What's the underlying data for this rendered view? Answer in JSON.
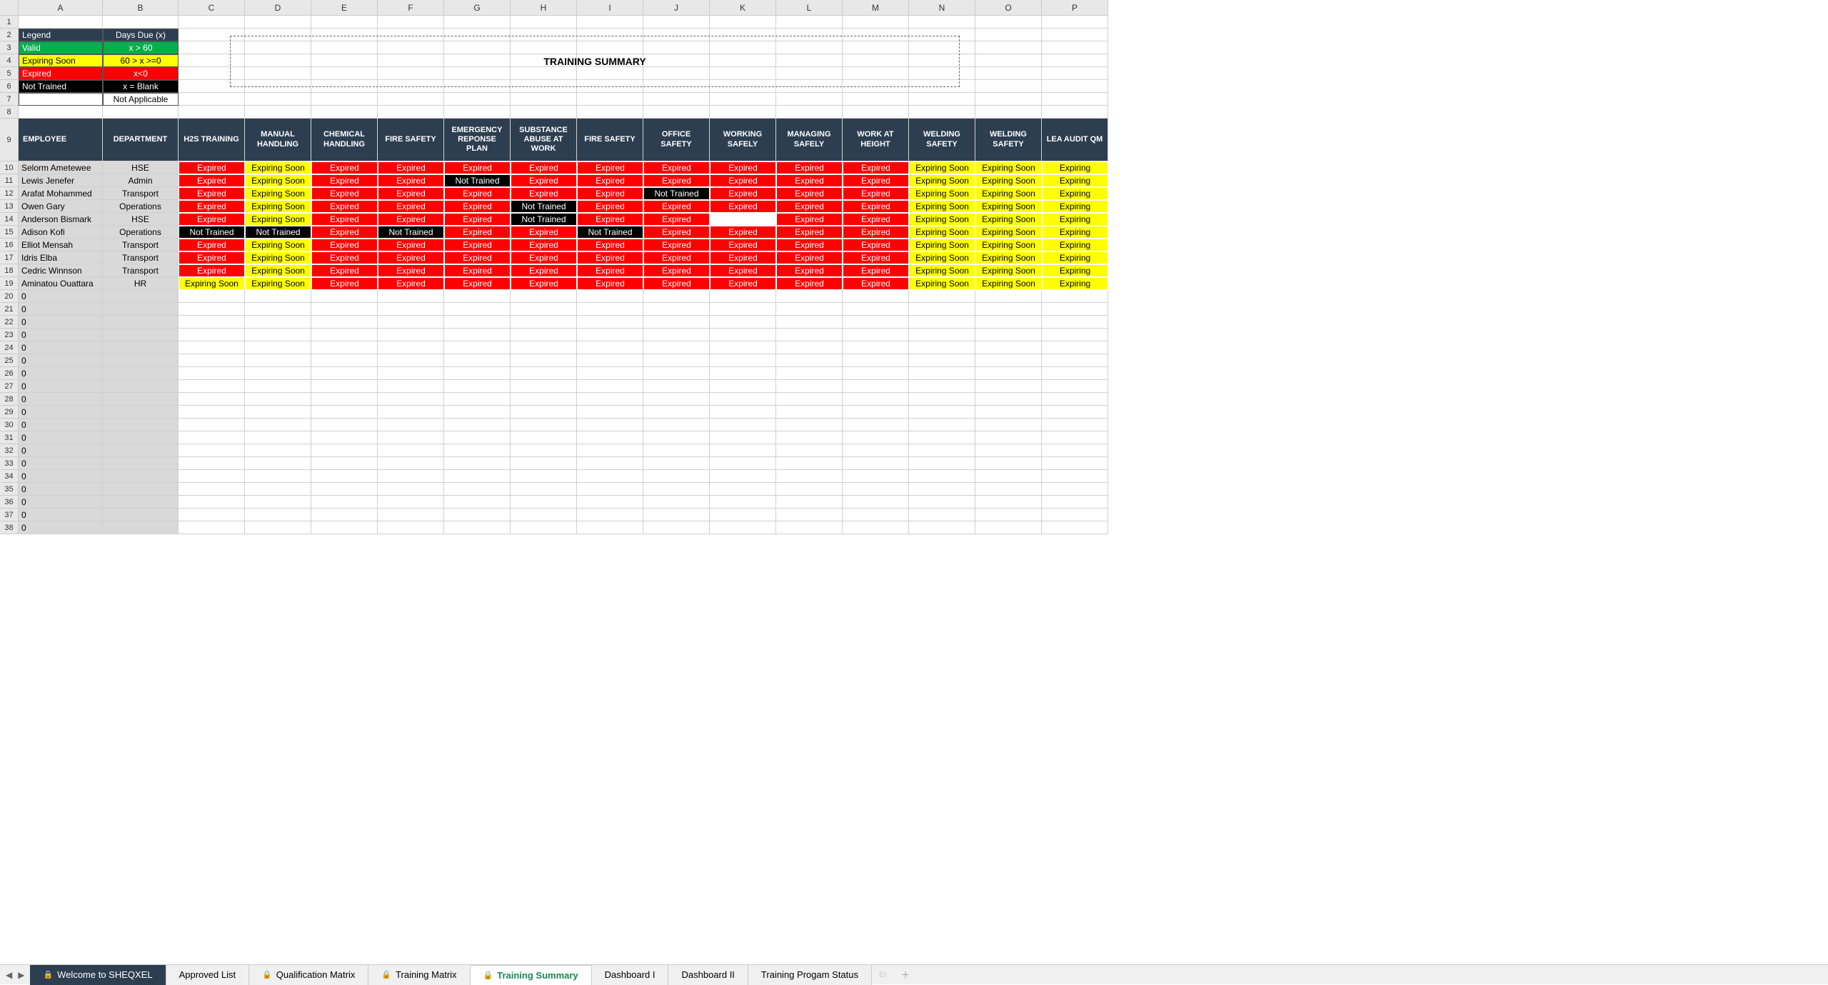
{
  "column_letters": [
    "A",
    "B",
    "C",
    "D",
    "E",
    "F",
    "G",
    "H",
    "I",
    "J",
    "K",
    "L",
    "M",
    "N",
    "O",
    "P"
  ],
  "visible_row_count": 38,
  "legend": {
    "header_left": "Legend",
    "header_right": "Days Due (x)",
    "rows": [
      {
        "label": "Valid",
        "rule": "x > 60",
        "cls": "legend-valid"
      },
      {
        "label": "Expiring Soon",
        "rule": "60 > x >=0",
        "cls": "legend-soon"
      },
      {
        "label": "Expired",
        "rule": "x<0",
        "cls": "legend-expired"
      },
      {
        "label": "Not Trained",
        "rule": "x = Blank",
        "cls": "legend-nottrained"
      },
      {
        "label": "",
        "rule": "Not Applicable",
        "cls": "legend-na"
      }
    ]
  },
  "title": "TRAINING SUMMARY",
  "table_headers": [
    "EMPLOYEE",
    "DEPARTMENT",
    "H2S TRAINING",
    "MANUAL HANDLING",
    "CHEMICAL HANDLING",
    "FIRE SAFETY",
    "EMERGENCY REPONSE PLAN",
    "SUBSTANCE ABUSE AT WORK",
    "FIRE SAFETY",
    "OFFICE SAFETY",
    "WORKING SAFELY",
    "MANAGING SAFELY",
    "WORK AT HEIGHT",
    "WELDING SAFETY",
    "WELDING SAFETY",
    "LEA AUDIT QM"
  ],
  "employees": [
    {
      "name": "Selorm Ametewee",
      "dept": "HSE",
      "s": [
        "Expired",
        "Expiring Soon",
        "Expired",
        "Expired",
        "Expired",
        "Expired",
        "Expired",
        "Expired",
        "Expired",
        "Expired",
        "Expired",
        "Expiring Soon",
        "Expiring Soon",
        "Expiring"
      ]
    },
    {
      "name": "Lewis Jenefer",
      "dept": "Admin",
      "s": [
        "Expired",
        "Expiring Soon",
        "Expired",
        "Expired",
        "Not Trained",
        "Expired",
        "Expired",
        "Expired",
        "Expired",
        "Expired",
        "Expired",
        "Expiring Soon",
        "Expiring Soon",
        "Expiring"
      ]
    },
    {
      "name": "Arafat Mohammed",
      "dept": "Transport",
      "s": [
        "Expired",
        "Expiring Soon",
        "Expired",
        "Expired",
        "Expired",
        "Expired",
        "Expired",
        "Not Trained",
        "Expired",
        "Expired",
        "Expired",
        "Expiring Soon",
        "Expiring Soon",
        "Expiring"
      ]
    },
    {
      "name": "Owen Gary",
      "dept": "Operations",
      "s": [
        "Expired",
        "Expiring Soon",
        "Expired",
        "Expired",
        "Expired",
        "Not Trained",
        "Expired",
        "Expired",
        "Expired",
        "Expired",
        "Expired",
        "Expiring Soon",
        "Expiring Soon",
        "Expiring"
      ]
    },
    {
      "name": "Anderson Bismark",
      "dept": "HSE",
      "s": [
        "Expired",
        "Expiring Soon",
        "Expired",
        "Expired",
        "Expired",
        "Not Trained",
        "Expired",
        "Expired",
        "",
        "Expired",
        "Expired",
        "Expiring Soon",
        "Expiring Soon",
        "Expiring"
      ]
    },
    {
      "name": "Adison Kofi",
      "dept": "Operations",
      "s": [
        "Not Trained",
        "Not Trained",
        "Expired",
        "Not Trained",
        "Expired",
        "Expired",
        "Not Trained",
        "Expired",
        "Expired",
        "Expired",
        "Expired",
        "Expiring Soon",
        "Expiring Soon",
        "Expiring"
      ]
    },
    {
      "name": "Elliot Mensah",
      "dept": "Transport",
      "s": [
        "Expired",
        "Expiring Soon",
        "Expired",
        "Expired",
        "Expired",
        "Expired",
        "Expired",
        "Expired",
        "Expired",
        "Expired",
        "Expired",
        "Expiring Soon",
        "Expiring Soon",
        "Expiring"
      ]
    },
    {
      "name": "Idris Elba",
      "dept": "Transport",
      "s": [
        "Expired",
        "Expiring Soon",
        "Expired",
        "Expired",
        "Expired",
        "Expired",
        "Expired",
        "Expired",
        "Expired",
        "Expired",
        "Expired",
        "Expiring Soon",
        "Expiring Soon",
        "Expiring"
      ]
    },
    {
      "name": "Cedric Winnson",
      "dept": "Transport",
      "s": [
        "Expired",
        "Expiring Soon",
        "Expired",
        "Expired",
        "Expired",
        "Expired",
        "Expired",
        "Expired",
        "Expired",
        "Expired",
        "Expired",
        "Expiring Soon",
        "Expiring Soon",
        "Expiring"
      ]
    },
    {
      "name": "Aminatou Ouattara",
      "dept": "HR",
      "s": [
        "Expiring Soon",
        "Expiring Soon",
        "Expired",
        "Expired",
        "Expired",
        "Expired",
        "Expired",
        "Expired",
        "Expired",
        "Expired",
        "Expired",
        "Expiring Soon",
        "Expiring Soon",
        "Expiring"
      ]
    }
  ],
  "zero_value": "0",
  "tabs": [
    {
      "label": "Welcome to SHEQXEL",
      "locked": true,
      "dark": true
    },
    {
      "label": "Approved List",
      "locked": false
    },
    {
      "label": "Qualification Matrix",
      "locked": true
    },
    {
      "label": "Training Matrix",
      "locked": true
    },
    {
      "label": "Training Summary",
      "locked": true,
      "active": true
    },
    {
      "label": "Dashboard I",
      "locked": false
    },
    {
      "label": "Dashboard II",
      "locked": false
    },
    {
      "label": "Training Progam Status",
      "locked": false
    }
  ],
  "tab_end_label": "Er"
}
